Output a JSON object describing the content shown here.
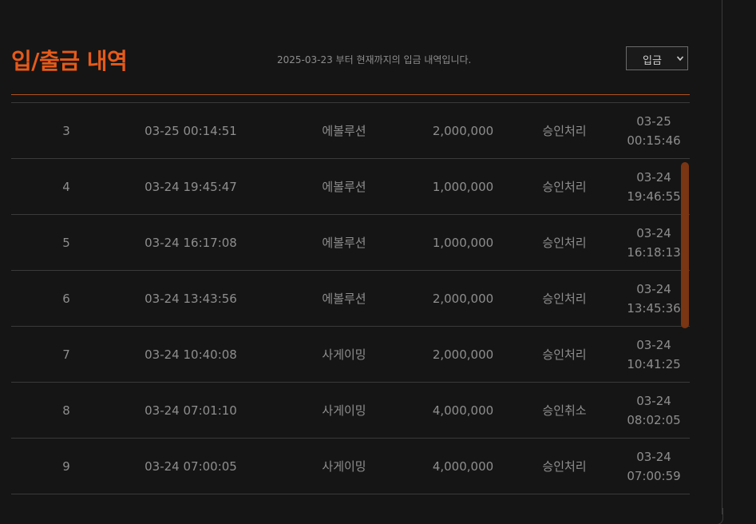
{
  "header": {
    "title": "입/출금 내역",
    "subtitle": "2025-03-23 부터 현재까지의 입금 내역입니다.",
    "select_value": "입금"
  },
  "colors": {
    "accent": "#e65a1a",
    "background": "#151515",
    "scroll_thumb": "#7a3512"
  },
  "rows": [
    {
      "num": "3",
      "time": "03-25 00:14:51",
      "game": "에볼루션",
      "amount": "2,000,000",
      "status": "승인처리",
      "done_date": "03-25",
      "done_time": "00:15:46"
    },
    {
      "num": "4",
      "time": "03-24 19:45:47",
      "game": "에볼루션",
      "amount": "1,000,000",
      "status": "승인처리",
      "done_date": "03-24",
      "done_time": "19:46:55"
    },
    {
      "num": "5",
      "time": "03-24 16:17:08",
      "game": "에볼루션",
      "amount": "1,000,000",
      "status": "승인처리",
      "done_date": "03-24",
      "done_time": "16:18:13"
    },
    {
      "num": "6",
      "time": "03-24 13:43:56",
      "game": "에볼루션",
      "amount": "2,000,000",
      "status": "승인처리",
      "done_date": "03-24",
      "done_time": "13:45:36"
    },
    {
      "num": "7",
      "time": "03-24 10:40:08",
      "game": "사게이밍",
      "amount": "2,000,000",
      "status": "승인처리",
      "done_date": "03-24",
      "done_time": "10:41:25"
    },
    {
      "num": "8",
      "time": "03-24 07:01:10",
      "game": "사게이밍",
      "amount": "4,000,000",
      "status": "승인취소",
      "done_date": "03-24",
      "done_time": "08:02:05"
    },
    {
      "num": "9",
      "time": "03-24 07:00:05",
      "game": "사게이밍",
      "amount": "4,000,000",
      "status": "승인처리",
      "done_date": "03-24",
      "done_time": "07:00:59"
    }
  ]
}
